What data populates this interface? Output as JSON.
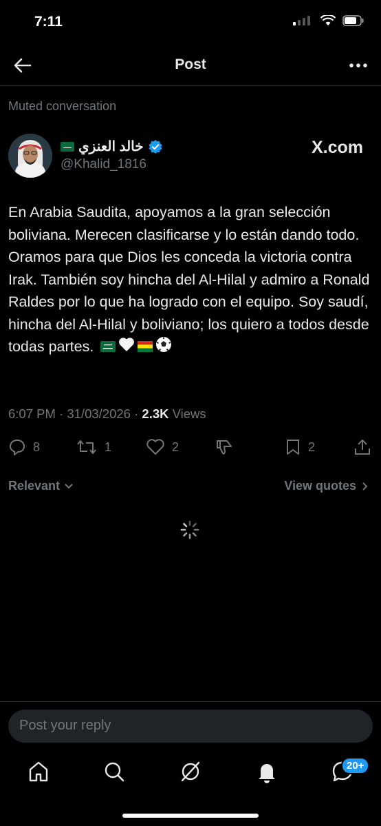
{
  "status": {
    "time": "7:11"
  },
  "header": {
    "title": "Post"
  },
  "muted_label": "Muted conversation",
  "tweet": {
    "author_name": "خالد العنزي",
    "handle": "@Khalid_1816",
    "source_logo_text": "X.com",
    "text": "En Arabia Saudita, apoyamos a la gran selección boliviana. Merecen clasificarse y lo están dando todo. Oramos para que Dios les conceda la victoria contra Irak. También soy hincha del Al-Hilal y admiro a Ronald Raldes por lo que ha logrado con el equipo. Soy saudí, hincha del Al-Hilal y boliviano; los quiero a todos desde todas partes.",
    "time": "6:07 PM",
    "date": "31/03/2026",
    "views_count": "2.3K",
    "views_label": "Views"
  },
  "actions": {
    "replies": "8",
    "reposts": "1",
    "likes": "2",
    "bookmarks": "2"
  },
  "filter": {
    "sort_label": "Relevant",
    "quotes_label": "View quotes"
  },
  "reply_box": {
    "placeholder": "Post your reply"
  },
  "tabbar": {
    "messages_badge": "20+"
  },
  "colors": {
    "accent": "#1d9bf0",
    "muted": "#71767b",
    "text": "#e7e9ea",
    "background": "#000000"
  }
}
